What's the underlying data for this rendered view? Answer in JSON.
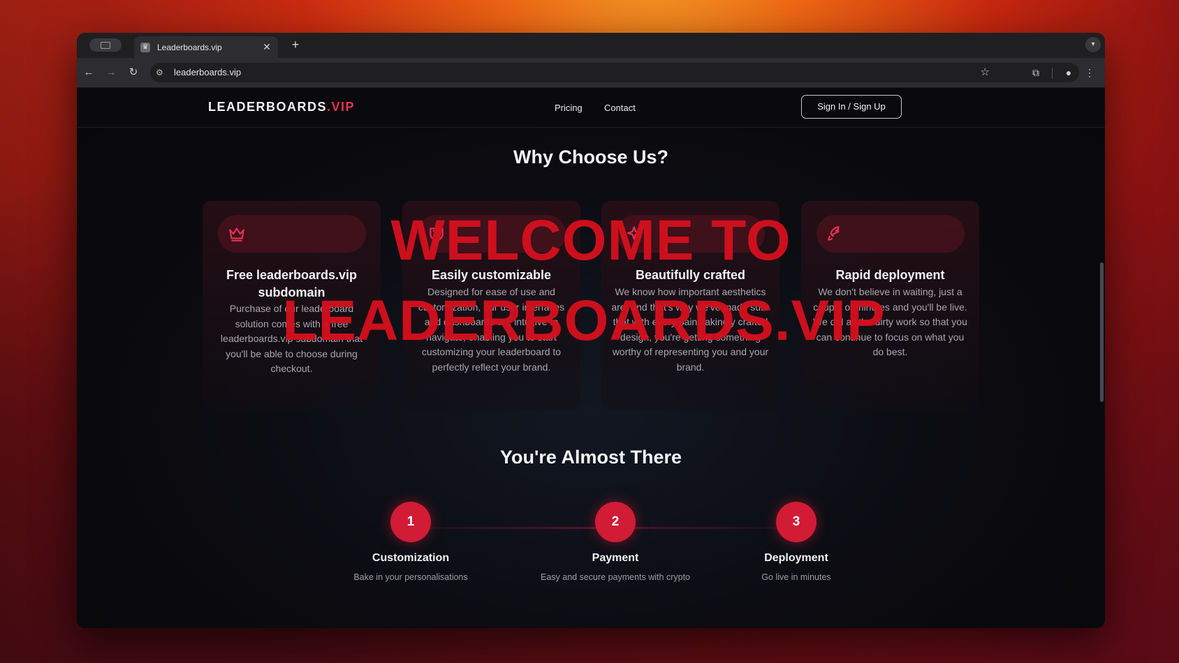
{
  "browser": {
    "tab_title": "Leaderboards.vip",
    "tab_close": "✕",
    "new_tab": "+",
    "url": "leaderboards.vip"
  },
  "header": {
    "logo_main": "LEADERBOARDS",
    "logo_accent": ".VIP",
    "nav": [
      "Pricing",
      "Contact"
    ],
    "signin_label": "Sign In / Sign Up"
  },
  "why": {
    "heading": "Why Choose Us?",
    "cards": [
      {
        "icon": "crown-icon",
        "title": "Free leaderboards.vip subdomain",
        "text": "Purchase of our leaderboard solution comes with a free leaderboards.vip subdomain that you'll be able to choose during checkout."
      },
      {
        "icon": "shield-icon",
        "title": "Easily customizable",
        "text": "Designed for ease of use and customization, our user interfaces and dashboards are intuitive to navigate, enabling you to start customizing your leaderboard to perfectly reflect your brand."
      },
      {
        "icon": "sparkles-icon",
        "title": "Beautifully crafted",
        "text": "We know how important aesthetics are, and that's why we've made sure that with every painstakingly crafted design, you're getting something worthy of representing you and your brand."
      },
      {
        "icon": "rocket-icon",
        "title": "Rapid deployment",
        "text": "We don't believe in waiting, just a couple of minutes and you'll be live. We did all the dirty work so that you can continue to focus on what you do best."
      }
    ]
  },
  "overlay": {
    "line1": "WELCOME TO",
    "line2": "LEADERBOARDS.VIP"
  },
  "steps": {
    "heading": "You're Almost There",
    "items": [
      {
        "number": "1",
        "title": "Customization",
        "desc": "Bake in your personalisations"
      },
      {
        "number": "2",
        "title": "Payment",
        "desc": "Easy and secure payments with crypto"
      },
      {
        "number": "3",
        "title": "Deployment",
        "desc": "Go live in minutes"
      }
    ]
  },
  "colors": {
    "accent": "#d21b35",
    "overlay_text": "#d4101e",
    "page_bg": "#0b0b10"
  }
}
